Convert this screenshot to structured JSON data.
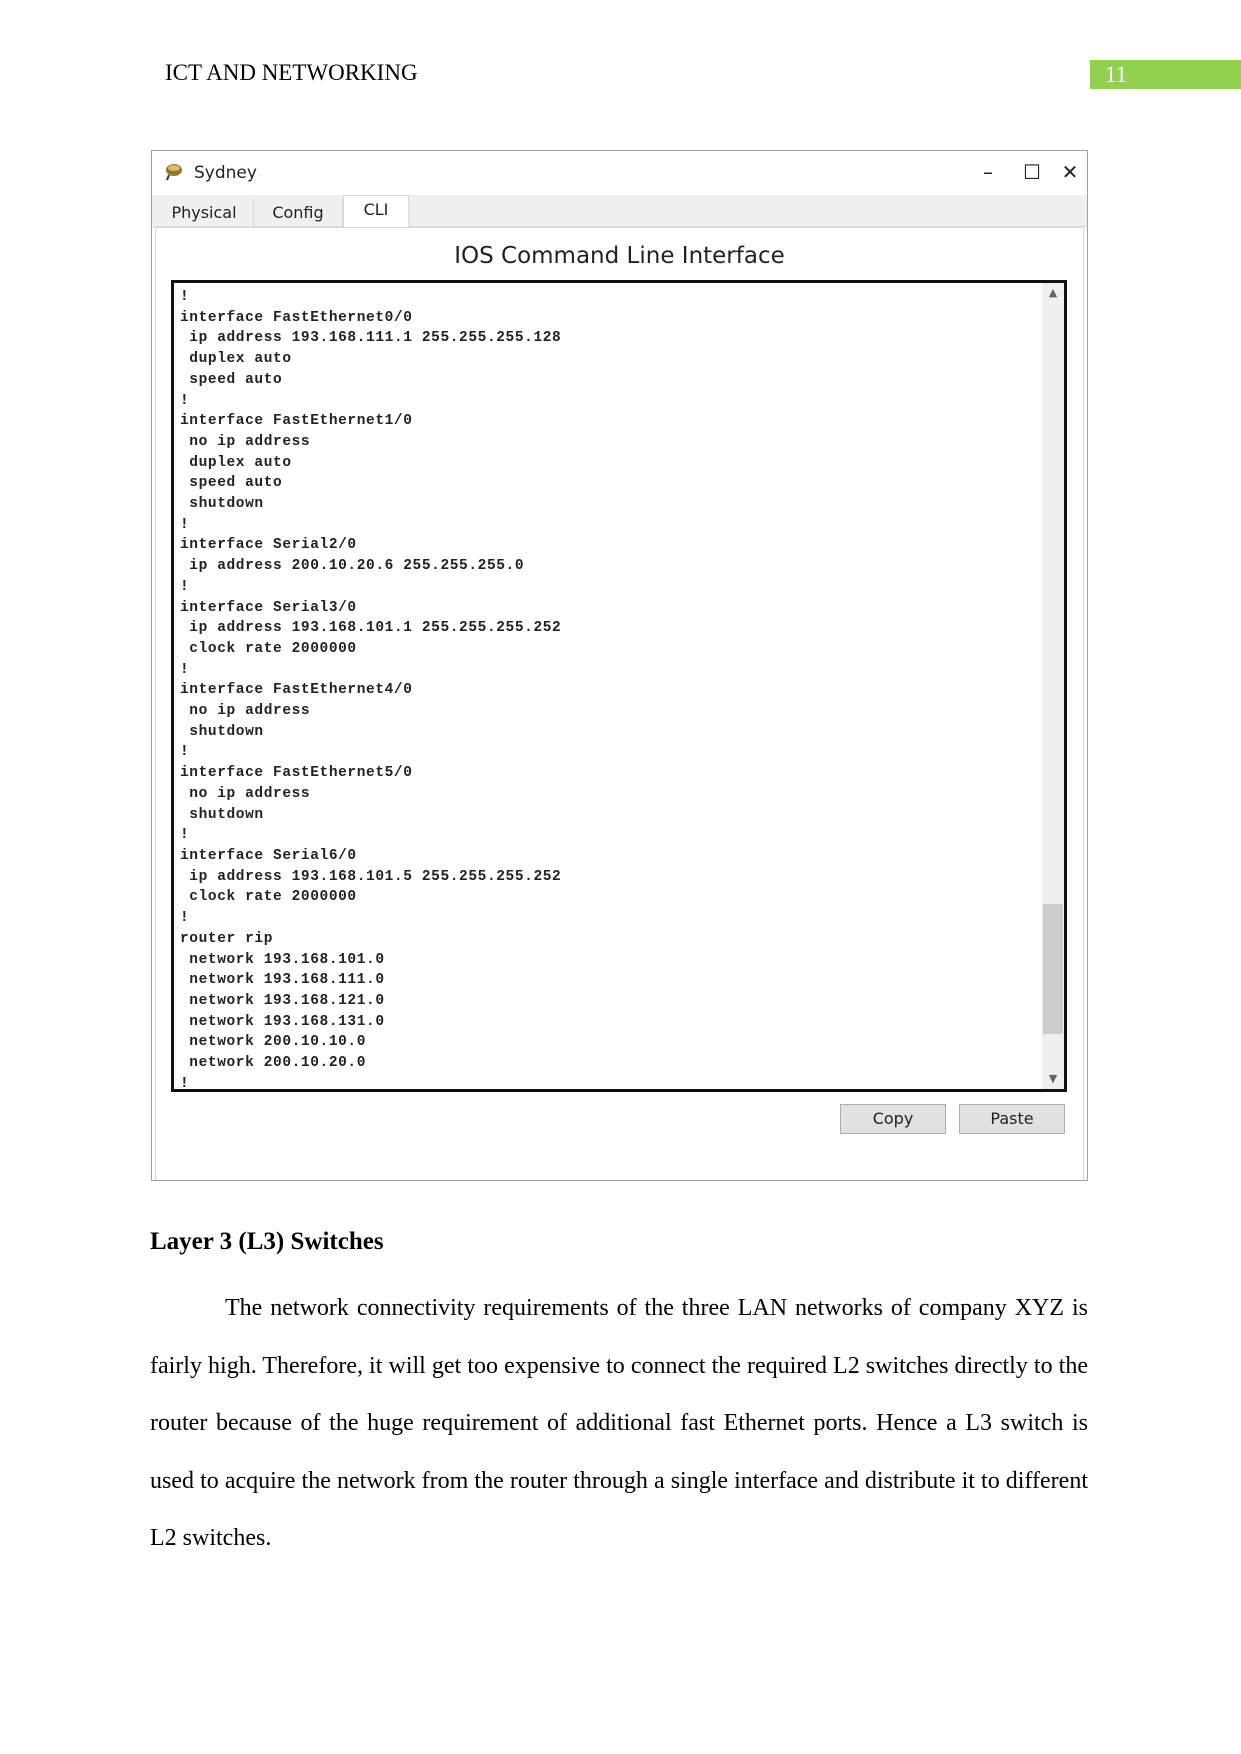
{
  "header": {
    "title": "ICT AND NETWORKING",
    "page_number": "11",
    "page_number_bg": "#92d050"
  },
  "window": {
    "title": "Sydney",
    "icon": "router-icon",
    "controls": {
      "minimize": "–",
      "maximize": "☐",
      "close": "✕"
    },
    "tabs": [
      {
        "label": "Physical"
      },
      {
        "label": "Config"
      },
      {
        "label": "CLI",
        "active": true
      }
    ],
    "cli_heading": "IOS Command Line Interface",
    "cli_text": "!\ninterface FastEthernet0/0\n ip address 193.168.111.1 255.255.255.128\n duplex auto\n speed auto\n!\ninterface FastEthernet1/0\n no ip address\n duplex auto\n speed auto\n shutdown\n!\ninterface Serial2/0\n ip address 200.10.20.6 255.255.255.0\n!\ninterface Serial3/0\n ip address 193.168.101.1 255.255.255.252\n clock rate 2000000\n!\ninterface FastEthernet4/0\n no ip address\n shutdown\n!\ninterface FastEthernet5/0\n no ip address\n shutdown\n!\ninterface Serial6/0\n ip address 193.168.101.5 255.255.255.252\n clock rate 2000000\n!\nrouter rip\n network 193.168.101.0\n network 193.168.111.0\n network 193.168.121.0\n network 193.168.131.0\n network 200.10.10.0\n network 200.10.20.0\n!",
    "copy_label": "Copy",
    "paste_label": "Paste"
  },
  "section": {
    "heading": "Layer 3 (L3) Switches",
    "paragraph": "The network connectivity requirements of the three LAN networks of company XYZ is fairly high. Therefore, it will get too expensive to connect the required L2 switches directly to the router because of the huge requirement of additional fast Ethernet ports. Hence a L3 switch is used to acquire the network from the router through a single interface and distribute it to different L2 switches."
  }
}
